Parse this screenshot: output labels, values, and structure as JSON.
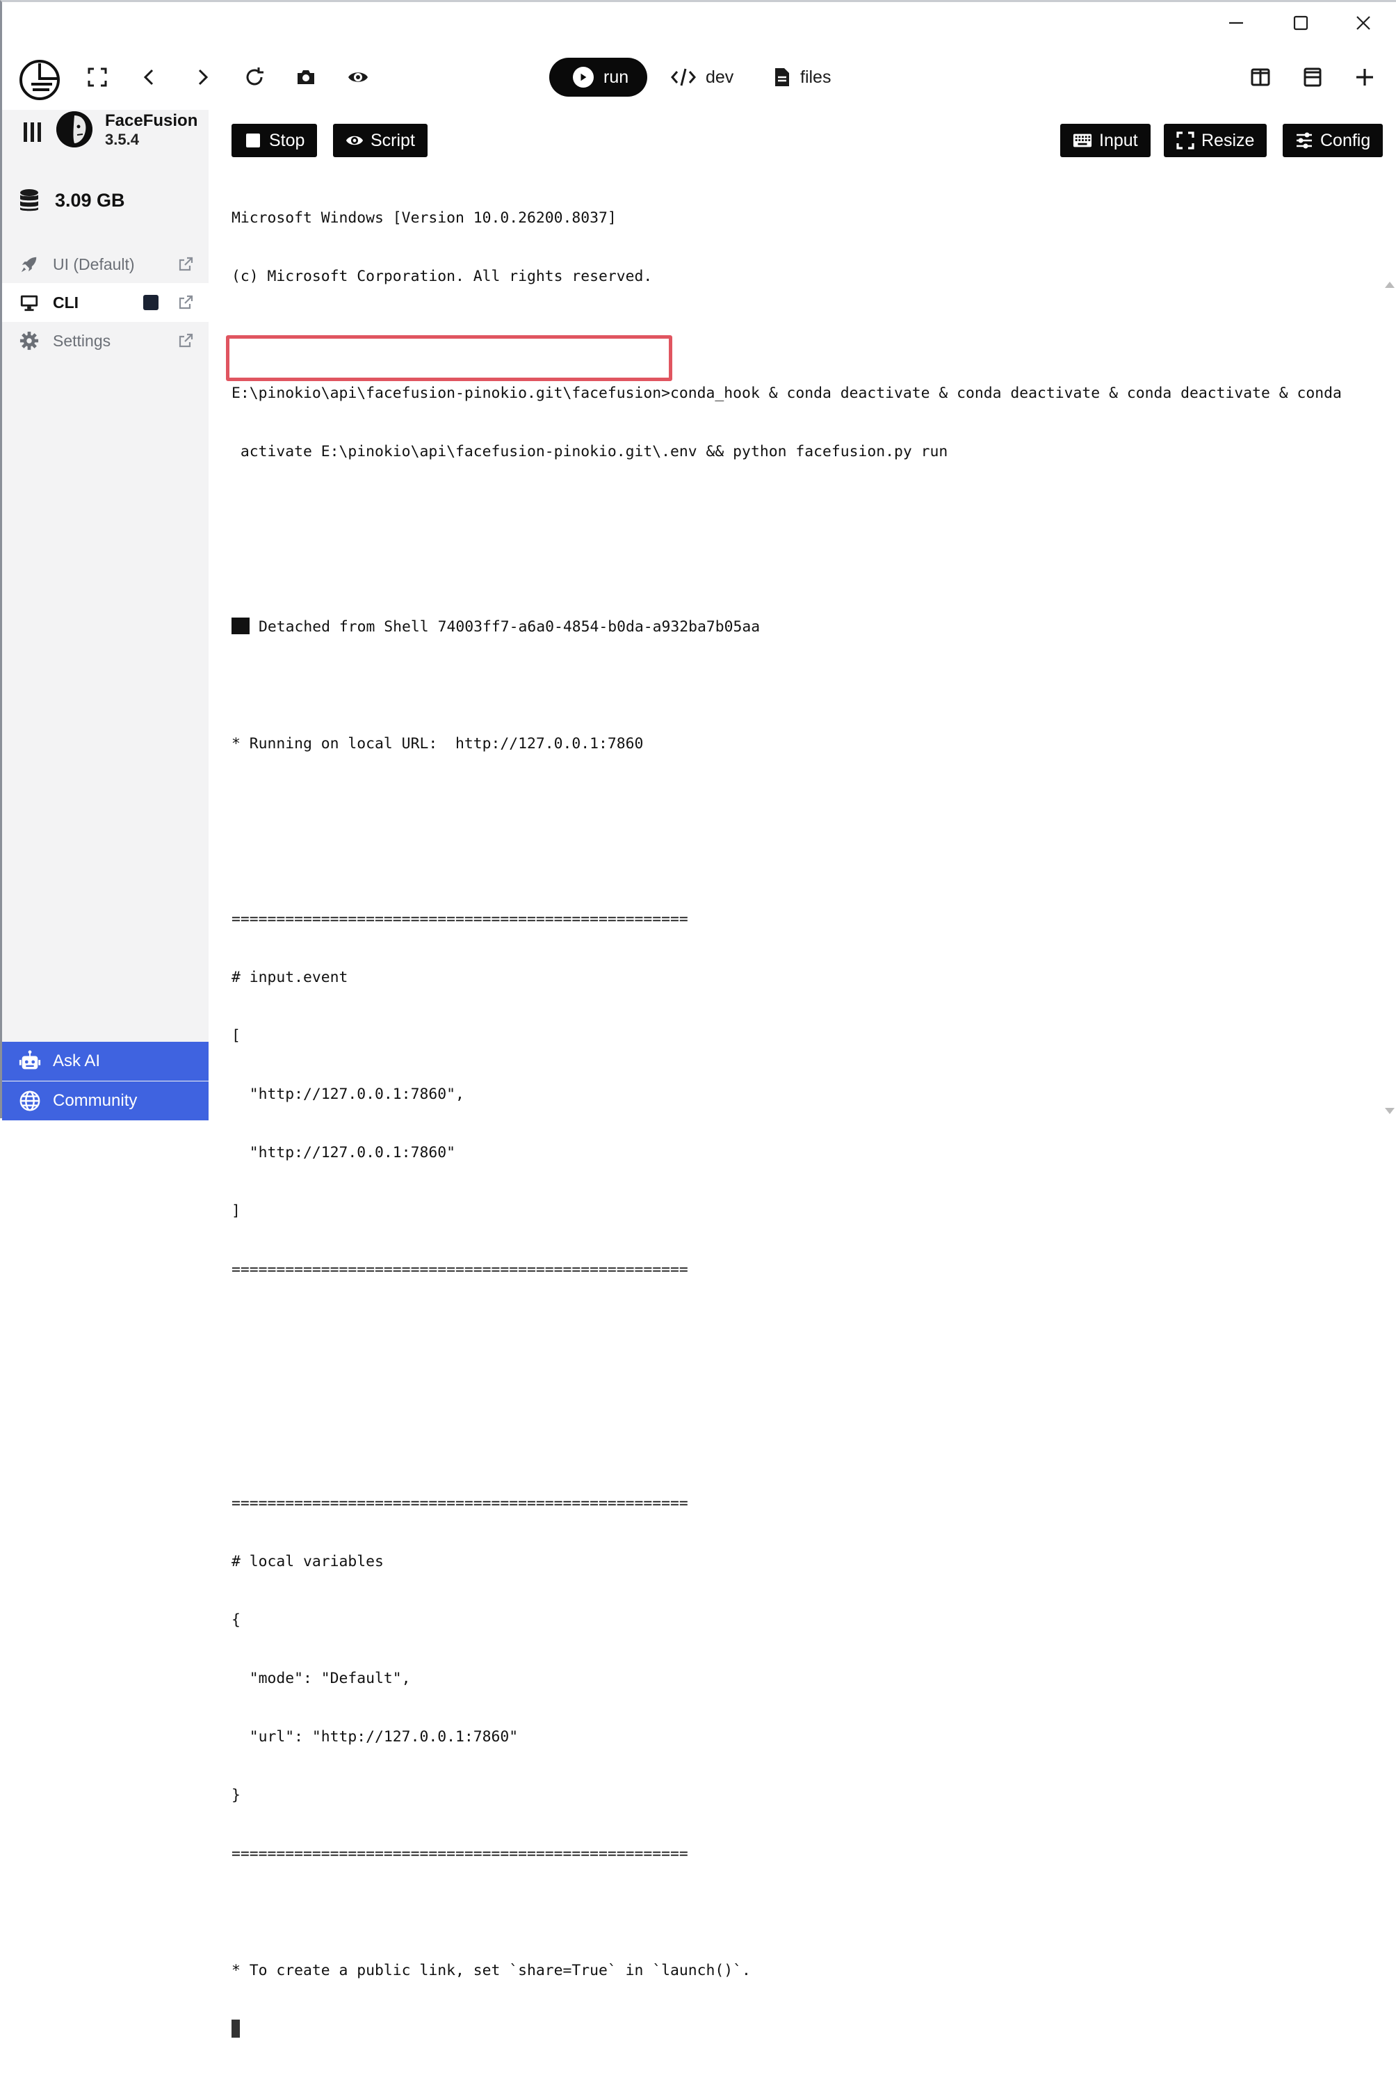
{
  "window": {
    "minimize_icon": "minimize-icon",
    "maximize_icon": "maximize-icon",
    "close_icon": "close-icon"
  },
  "toolbar": {
    "icons": [
      "pinokio-logo",
      "fullscreen-icon",
      "back-icon",
      "forward-icon",
      "refresh-icon",
      "camera-icon",
      "eye-icon",
      "split-vertical-icon",
      "split-horizontal-icon",
      "plus-icon"
    ],
    "tabs": [
      {
        "label": "run",
        "active": true
      },
      {
        "label": "dev",
        "active": false
      },
      {
        "label": "files",
        "active": false
      }
    ]
  },
  "sidebar": {
    "app_name": "FaceFusion",
    "app_version": "3.5.4",
    "disk_usage": "3.09 GB",
    "items": [
      {
        "label": "UI (Default)",
        "icon": "rocket-icon",
        "active": false
      },
      {
        "label": "CLI",
        "icon": "monitor-icon",
        "active": true
      },
      {
        "label": "Settings",
        "icon": "gear-icon",
        "active": false
      }
    ],
    "bottom": [
      {
        "label": "Ask AI",
        "icon": "robot-icon"
      },
      {
        "label": "Community",
        "icon": "globe-icon"
      }
    ]
  },
  "actions": {
    "stop": "Stop",
    "script": "Script",
    "input": "Input",
    "resize": "Resize",
    "config": "Config"
  },
  "terminal": {
    "lines": [
      "Microsoft Windows [Version 10.0.26200.8037]",
      "(c) Microsoft Corporation. All rights reserved.",
      "",
      "E:\\pinokio\\api\\facefusion-pinokio.git\\facefusion>conda_hook & conda deactivate & conda deactivate & conda deactivate & conda",
      " activate E:\\pinokio\\api\\facefusion-pinokio.git\\.env && python facefusion.py run",
      "",
      "",
      "Detached from Shell 74003ff7-a6a0-4854-b0da-a932ba7b05aa",
      "",
      "* Running on local URL:  http://127.0.0.1:7860",
      "",
      "",
      "===================================================",
      "# input.event",
      "[",
      "  \"http://127.0.0.1:7860\",",
      "  \"http://127.0.0.1:7860\"",
      "]",
      "===================================================",
      "",
      "",
      "",
      "===================================================",
      "# local variables",
      "{",
      "  \"mode\": \"Default\",",
      "  \"url\": \"http://127.0.0.1:7860\"",
      "}",
      "===================================================",
      "",
      "* To create a public link, set `share=True` in `launch()`."
    ]
  },
  "colors": {
    "accent_blue": "#3f63e0",
    "highlight_red": "#e05560",
    "button_black": "#0a0a0a",
    "sidebar_bg": "#f3f3f4"
  }
}
